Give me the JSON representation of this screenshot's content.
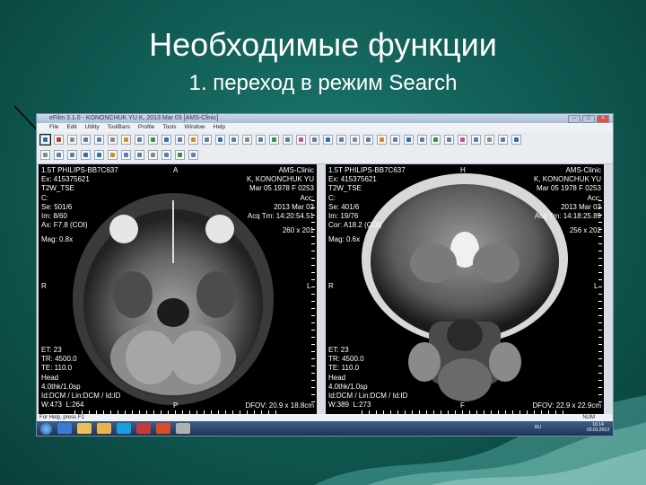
{
  "slide": {
    "title": "Необходимые функции",
    "subtitle": "1. переход в режим Search"
  },
  "window": {
    "title": "eFilm 3.1.0 - KONONCHUK YU K, 2013 Mar 03 [AMS-Clinic]",
    "menu": [
      "File",
      "Edit",
      "Utility",
      "ToolBars",
      "Profile",
      "Tools",
      "Window",
      "Help"
    ]
  },
  "viewports": [
    {
      "top_left": "1.5T PHILIPS-BB7C637\nEx: 415375621\nT2W_TSE\nC:\nSe: 501/6\nIm: 8/60\nAx: F7.8 (COI)",
      "top_center": "A",
      "top_right": "AMS-Clinic\nK, KONONCHUK YU\nMar 05 1978 F 0253\nAcc:\n2013 Mar 03\nAcq Tm: 14:20:54.51",
      "matrix": "260 x 201",
      "mag": "Mag: 0.8x",
      "left_mark": "R",
      "right_mark": "L",
      "bottom_left": "ET: 23\nTR: 4500.0\nTE: 110.0\nHead\n4.0thk/1.0sp\nId:DCM / Lin:DCM / Id:ID\nW:473  L:264",
      "bottom_center": "P",
      "bottom_right": "DFOV: 20.9 x 18.8cm"
    },
    {
      "top_left": "1.5T PHILIPS-BB7C637\nEx: 415375621\nT2W_TSE\nC:\nSe: 401/6\nIm: 19/76\nCor: A18.2 (COI)",
      "top_center": "H",
      "top_right": "AMS-Clinic\nK, KONONCHUK YU\nMar 05 1978 F 0253\nAcc:\n2013 Mar 03\nAcq Tm: 14:18:25.89",
      "matrix": "256 x 202",
      "mag": "Mag: 0.6x",
      "left_mark": "R",
      "right_mark": "L",
      "bottom_left": "ET: 23\nTR: 4500.0\nTE: 110.0\nHead\n4.0thk/1.0sp\nId:DCM / Lin:DCM / Id:ID\nW:389  L:273",
      "bottom_center": "F",
      "bottom_right": "DFOV: 22.9 x 22.9cm"
    }
  ],
  "statusbar": {
    "hint": "For Help, press F1",
    "num": "NUM"
  },
  "taskbar": {
    "lang": "RU",
    "time": "16:14",
    "date": "03.03.2013"
  },
  "colors": {
    "background": "#0f5a52",
    "title": "#ffffff"
  }
}
